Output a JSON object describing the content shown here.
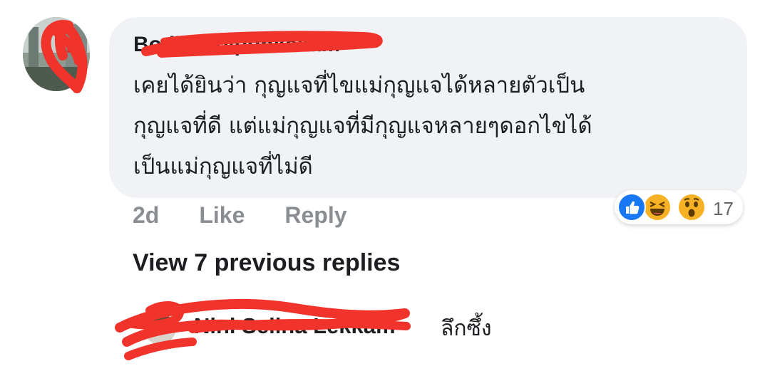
{
  "comment": {
    "author": "Bodin Boiponkakam",
    "lines": [
      "เคยได้ยินว่า กุญแจที่ไขแม่กุญแจได้หลายตัวเป็น",
      "กุญแจที่ดี แต่แม่กุญแจที่มีกุญแจหลายๆดอกไขได้",
      "เป็นแม่กุญแจที่ไม่ดี"
    ],
    "time": "2d",
    "like_label": "Like",
    "reply_label": "Reply",
    "reactions": {
      "icons": [
        "like-icon",
        "haha-icon",
        "wow-icon"
      ],
      "count": "17",
      "colors": {
        "like": "#1877f2",
        "haha": "#f7b125",
        "wow": "#f7b125"
      }
    }
  },
  "view_previous": "View 7 previous replies",
  "reply": {
    "author": "Nini Selina Lekkam",
    "text": "ลึกซึ้ง"
  },
  "colors": {
    "bubble": "#f0f2f5",
    "redaction": "#f0332b",
    "muted": "#8a8d91"
  }
}
